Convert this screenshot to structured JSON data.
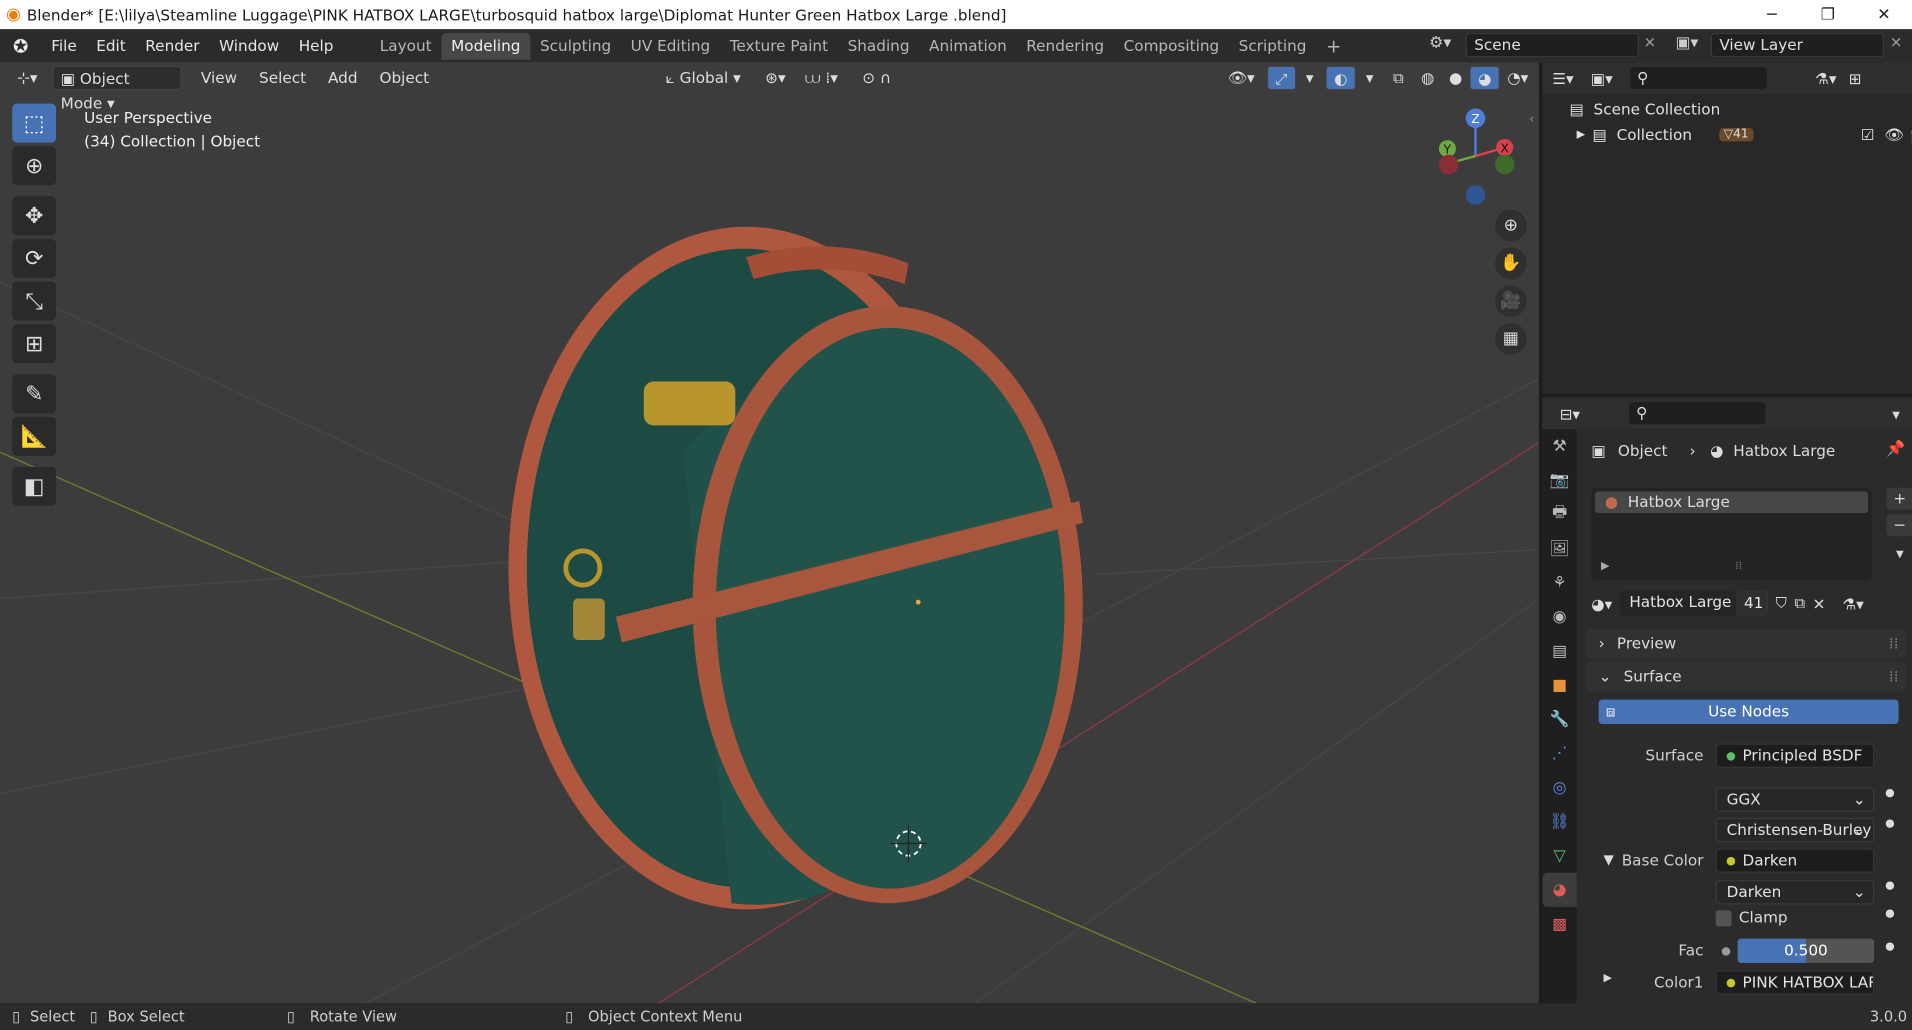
{
  "window": {
    "title": "Blender* [E:\\lilya\\Steamline Luggage\\PINK HATBOX LARGE\\turbosquid hatbox large\\Diplomat Hunter Green Hatbox Large .blend]",
    "minimize": "─",
    "maximize": "❐",
    "close": "✕"
  },
  "menu": [
    "File",
    "Edit",
    "Render",
    "Window",
    "Help"
  ],
  "workspaces": [
    "Layout",
    "Modeling",
    "Sculpting",
    "UV Editing",
    "Texture Paint",
    "Shading",
    "Animation",
    "Rendering",
    "Compositing",
    "Scripting"
  ],
  "workspace_active": 1,
  "workspace_add": "+",
  "scene": "Scene",
  "view_layer": "View Layer",
  "viewport": {
    "mode": "Object Mode",
    "menus": [
      "View",
      "Select",
      "Add",
      "Object"
    ],
    "orientation": "Global",
    "perspective": "User Perspective",
    "collection_info": "(34) Collection | Object",
    "gizmo": {
      "z": "Z",
      "y": "Y",
      "x": "X"
    }
  },
  "outliner": {
    "scene_collection": "Scene Collection",
    "collection": "Collection",
    "collection_count": "41"
  },
  "properties": {
    "breadcrumb_object": "Object",
    "breadcrumb_material": "Hatbox Large",
    "slot_name": "Hatbox Large",
    "material_name": "Hatbox Large",
    "material_users": "41",
    "panel_preview": "Preview",
    "panel_surface": "Surface",
    "use_nodes": "Use Nodes",
    "surface_label": "Surface",
    "surface_value": "Principled BSDF",
    "distribution": "GGX",
    "subsurface": "Christensen-Burley",
    "base_color_label": "Base Color",
    "base_color_value": "Darken",
    "blend_mode": "Darken",
    "clamp_label": "Clamp",
    "fac_label": "Fac",
    "fac_value": "0.500",
    "fac_fraction": 0.5,
    "color1_label": "Color1",
    "color1_value": "PINK HATBOX LAR..."
  },
  "status": {
    "select": "Select",
    "box_select": "Box Select",
    "rotate_view": "Rotate View",
    "context_menu": "Object Context Menu",
    "version": "3.0.0"
  },
  "colors": {
    "accent": "#4772b3",
    "leather": "#a5523f",
    "fabric": "#1d4d46",
    "brass": "#b8962a"
  }
}
